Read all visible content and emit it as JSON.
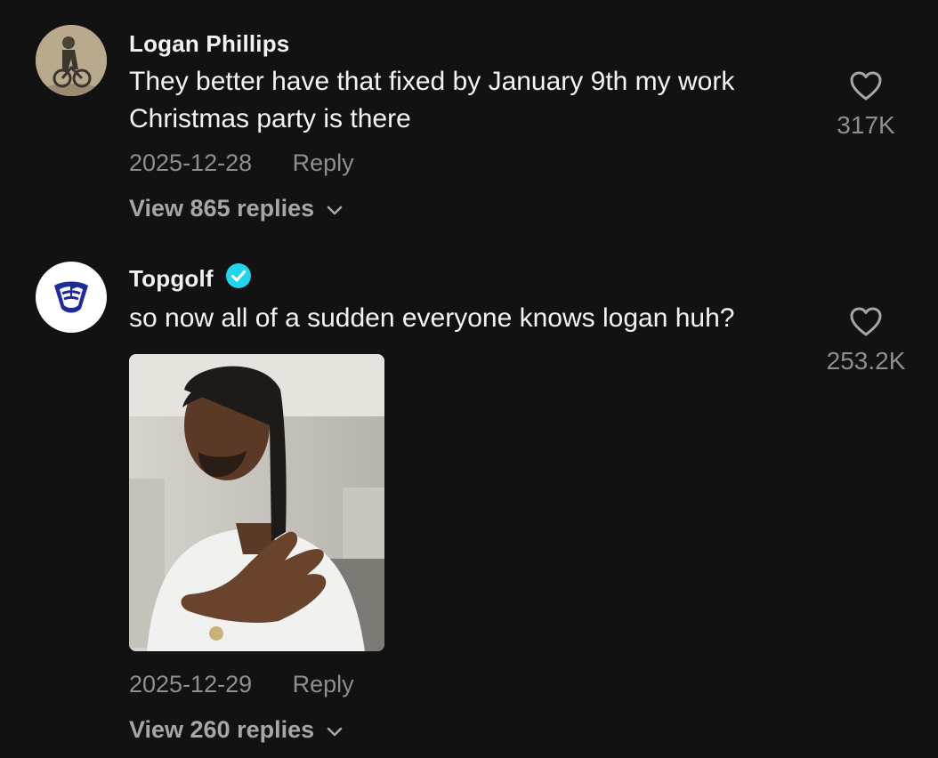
{
  "comments": [
    {
      "username": "Logan Phillips",
      "text": "They better have that fixed by January 9th my work Christmas party is there",
      "date": "2025-12-28",
      "reply_label": "Reply",
      "view_replies": "View 865 replies",
      "likes": "317K",
      "verified": false
    },
    {
      "username": "Topgolf",
      "text": "so now all of a sudden everyone knows logan huh?",
      "date": "2025-12-29",
      "reply_label": "Reply",
      "view_replies": "View 260 replies",
      "likes": "253.2K",
      "verified": true,
      "has_gif": true
    }
  ],
  "colors": {
    "background": "#121212",
    "muted_text": "#8e8e8e",
    "verified_badge": "#20d5ec",
    "brand_blue": "#1f2a9c"
  }
}
